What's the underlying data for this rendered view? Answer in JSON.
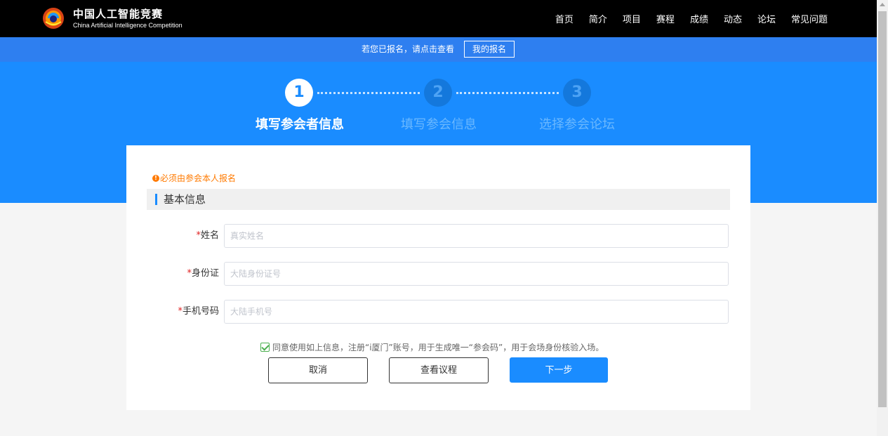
{
  "header": {
    "logo_cn": "中国人工智能竞赛",
    "logo_en": "China Artificial Intelligence Competition",
    "nav": [
      "首页",
      "简介",
      "项目",
      "赛程",
      "成绩",
      "动态",
      "论坛",
      "常见问题"
    ]
  },
  "notice": {
    "text": "若您已报名，请点击查看",
    "button": "我的报名"
  },
  "steps": [
    {
      "number": "1",
      "label": "填写参会者信息",
      "active": true
    },
    {
      "number": "2",
      "label": "填写参会信息",
      "active": false
    },
    {
      "number": "3",
      "label": "选择参会论坛",
      "active": false
    }
  ],
  "form": {
    "warning": "必须由参会本人报名",
    "section_title": "基本信息",
    "required_mark": "*",
    "fields": [
      {
        "label": "姓名",
        "placeholder": "真实姓名",
        "value": ""
      },
      {
        "label": "身份证",
        "placeholder": "大陆身份证号",
        "value": ""
      },
      {
        "label": "手机号码",
        "placeholder": "大陆手机号",
        "value": ""
      }
    ],
    "agreement": "同意使用如上信息，注册“i厦门”账号，用于生成唯一“参会码”，用于会场身份核验入场。",
    "agreement_checked": true
  },
  "buttons": {
    "cancel": "取消",
    "agenda": "查看议程",
    "next": "下一步"
  },
  "colors": {
    "primary": "#1a8cff",
    "notice_bar": "#2e7ff0",
    "warning": "#ff7a00",
    "required": "#e02020"
  }
}
